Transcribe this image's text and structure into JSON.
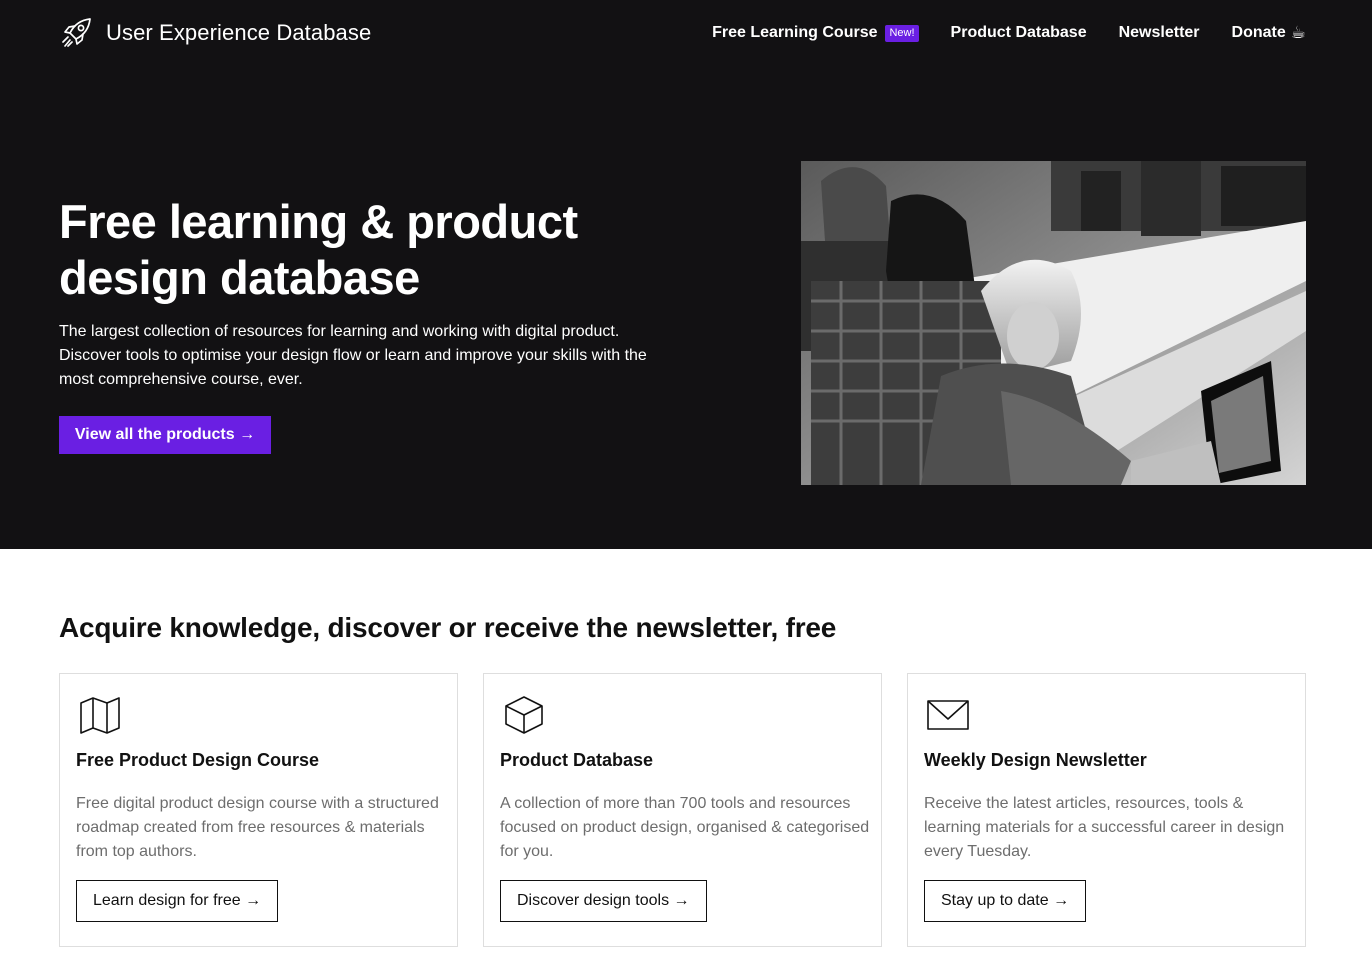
{
  "header": {
    "brand_name": "User Experience Database",
    "logo_icon": "rocket-icon",
    "nav": [
      {
        "label": "Free Learning Course",
        "badge": "New!"
      },
      {
        "label": "Product Database"
      },
      {
        "label": "Newsletter"
      },
      {
        "label": "Donate",
        "icon": "coffee-icon",
        "glyph": "☕"
      }
    ]
  },
  "hero": {
    "title": "Free learning & product design database",
    "subtitle": "The largest collection of resources for learning and working with digital product. Discover tools to optimise your design flow or learn and improve your skills with the most comprehensive course, ever.",
    "cta_label": "View all the products →",
    "image": "black-and-white photo of students working on laptops"
  },
  "section": {
    "title": "Acquire knowledge, discover or receive the newsletter, free"
  },
  "cards": [
    {
      "icon": "book-icon",
      "title": "Free Product Design Course",
      "description": "Free digital product design course with a structured roadmap created from free resources & materials from top authors.",
      "button": "Learn design for free →"
    },
    {
      "icon": "cube-icon",
      "title": "Product Database",
      "description": "A collection of more than 700 tools and resources focused on product design, organised & categorised for you.",
      "button": "Discover design tools →"
    },
    {
      "icon": "envelope-icon",
      "title": "Weekly Design Newsletter",
      "description": "Receive the latest articles, resources, tools & learning materials for a successful career in design every Tuesday.",
      "button": "Stay up to date →"
    }
  ],
  "colors": {
    "hero_background": "#121113",
    "accent": "#6a1fe3",
    "card_border": "#dedede",
    "body_text": "#6d6d6d"
  }
}
